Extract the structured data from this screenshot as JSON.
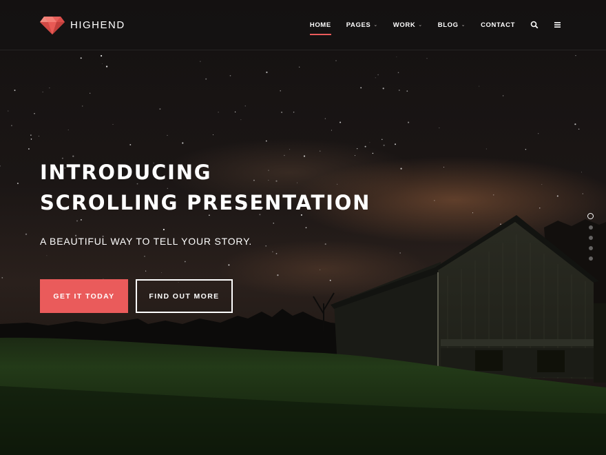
{
  "brand": {
    "name": "HIGHEND",
    "accent_color": "#ea5b5b",
    "logo_icon": "ruby-gem-icon"
  },
  "nav": {
    "items": [
      {
        "label": "HOME",
        "active": true,
        "has_dropdown": false
      },
      {
        "label": "PAGES",
        "active": false,
        "has_dropdown": true
      },
      {
        "label": "WORK",
        "active": false,
        "has_dropdown": true
      },
      {
        "label": "BLOG",
        "active": false,
        "has_dropdown": true
      },
      {
        "label": "CONTACT",
        "active": false,
        "has_dropdown": false
      }
    ],
    "dropdown_glyph": "⌄",
    "icons": [
      "search-icon",
      "menu-icon"
    ]
  },
  "hero": {
    "title_line1": "INTRODUCING",
    "title_line2": "SCROLLING PRESENTATION",
    "subtitle": "A BEAUTIFUL WAY TO TELL YOUR STORY.",
    "primary_button": "GET IT TODAY",
    "secondary_button": "FIND OUT MORE",
    "background": "night sky over a barn on a grassy hill"
  },
  "pagination": {
    "count": 5,
    "active_index": 0
  }
}
